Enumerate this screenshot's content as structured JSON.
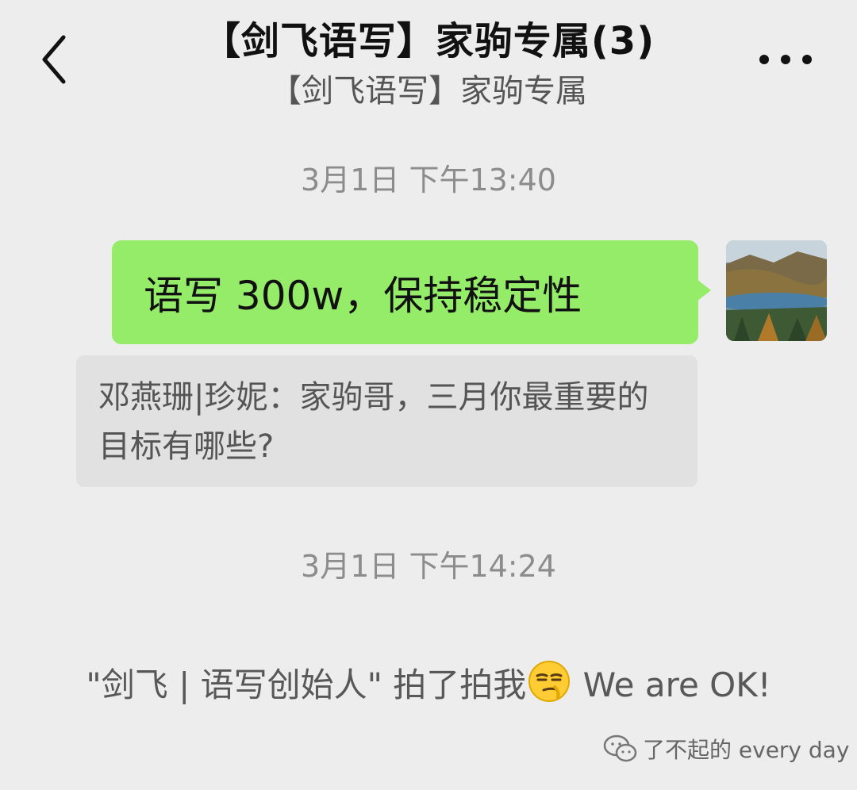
{
  "header": {
    "back_icon": "chevron-left-icon",
    "title": "【剑飞语写】家驹专属(3)",
    "subtitle": "【剑飞语写】家驹专属",
    "more_icon": "more-dots-icon"
  },
  "messages": {
    "timestamp_1": "3月1日 下午13:40",
    "outgoing_text": "语写 300w，保持稳定性",
    "quote_text": "邓燕珊|珍妮：家驹哥，三月你最重要的目标有哪些?",
    "timestamp_2": "3月1日 下午14:24",
    "pat_text_before": "\"剑飞 | 语写创始人\" 拍了拍我",
    "pat_emoji": "smirk-emoji",
    "pat_text_after": " We are OK!"
  },
  "watermark": {
    "icon": "wechat-icon",
    "text": "了不起的 every day"
  },
  "colors": {
    "background": "#ededed",
    "outgoing_bubble": "#95ec69",
    "quote_bubble": "#e1e1e1"
  }
}
